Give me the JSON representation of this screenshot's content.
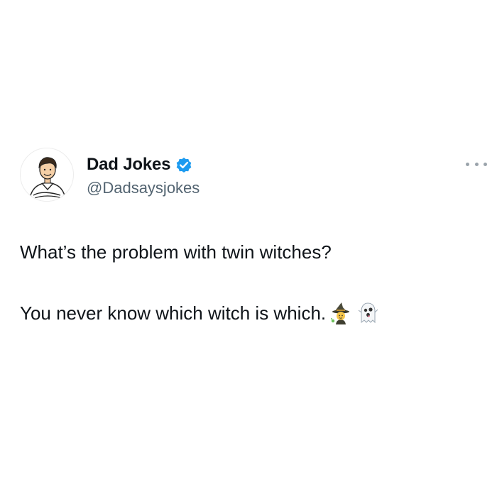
{
  "account": {
    "display_name": "Dad Jokes",
    "handle": "@Dadsaysjokes",
    "verified": true,
    "verified_color": "#1d9bf0"
  },
  "menu": {
    "icon": "more-horizontal-icon"
  },
  "tweet": {
    "line1": "What’s the problem with twin witches?",
    "line2": "You never know which witch is which.",
    "emojis": [
      "witch-emoji",
      "ghost-emoji"
    ]
  }
}
